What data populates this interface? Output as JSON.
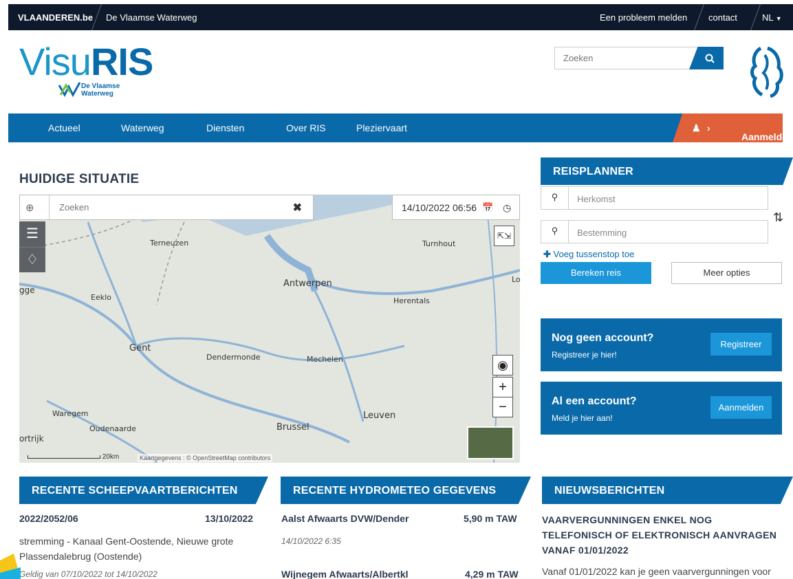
{
  "topbar": {
    "site": "VLAANDEREN.be",
    "org": "De Vlaamse Waterweg",
    "report": "Een probleem melden",
    "contact": "contact",
    "lang": "NL"
  },
  "logo": {
    "visu": "Visu",
    "ris": "RIS",
    "sub1": "De Vlaamse",
    "sub2": "Waterweg"
  },
  "header_search": {
    "placeholder": "Zoeken"
  },
  "nav": {
    "items": [
      "Actueel",
      "Waterweg",
      "Diensten",
      "Over RIS",
      "Pleziervaart"
    ],
    "login": "Aanmelden"
  },
  "situation": {
    "title": "HUIDIGE SITUATIE"
  },
  "map": {
    "search_placeholder": "Zoeken",
    "datetime": "14/10/2022 06:56",
    "scale": "20km",
    "attribution": "Kaartgegevens : © OpenStreetMap contributors",
    "cities": [
      "Terneuzen",
      "Turnhout",
      "Antwerpen",
      "Eeklo",
      "Herentals",
      "Gent",
      "Dendermonde",
      "Mechelen",
      "Waregem",
      "Leuven",
      "Oudenaarde",
      "Brussel",
      "ortrijk",
      "gge",
      "Lo"
    ]
  },
  "reisplanner": {
    "title": "REISPLANNER",
    "from": "Herkomst",
    "to": "Bestemming",
    "add_stop": "Voeg tussenstop toe",
    "calc": "Bereken reis",
    "more": "Meer opties"
  },
  "account_new": {
    "title": "Nog geen account?",
    "sub": "Registreer je hier!",
    "button": "Registreer"
  },
  "account_existing": {
    "title": "Al een account?",
    "sub": "Meld je hier aan!",
    "button": "Aanmelden"
  },
  "shipping": {
    "title": "RECENTE SCHEEPVAARTBERICHTEN",
    "id": "2022/2052/06",
    "date": "13/10/2022",
    "text": "stremming - Kanaal Gent-Oostende, Nieuwe grote Plassendalebrug (Oostende)",
    "validity": "Geldig van 07/10/2022 tot 14/10/2022"
  },
  "hydro": {
    "title": "RECENTE HYDROMETEO GEGEVENS",
    "items": [
      {
        "name": "Aalst Afwaarts DVW/Dender",
        "value": "5,90 m TAW",
        "time": "14/10/2022 6:35"
      },
      {
        "name": "Wijnegem Afwaarts/Albertkl",
        "value": "4,29 m TAW"
      }
    ]
  },
  "news": {
    "title": "NIEUWSBERICHTEN",
    "headline": "VAARVERGUNNINGEN ENKEL NOG TELEFONISCH OF ELEKTRONISCH AANVRAGEN VANAF 01/01/2022",
    "text": "Vanaf 01/01/2022 kan je geen vaarvergunningen voor"
  },
  "colors": {
    "brand": "#0a6aa9",
    "accent": "#e0603a",
    "light_blue": "#1a96d9",
    "topbar": "#0e1a2b"
  }
}
